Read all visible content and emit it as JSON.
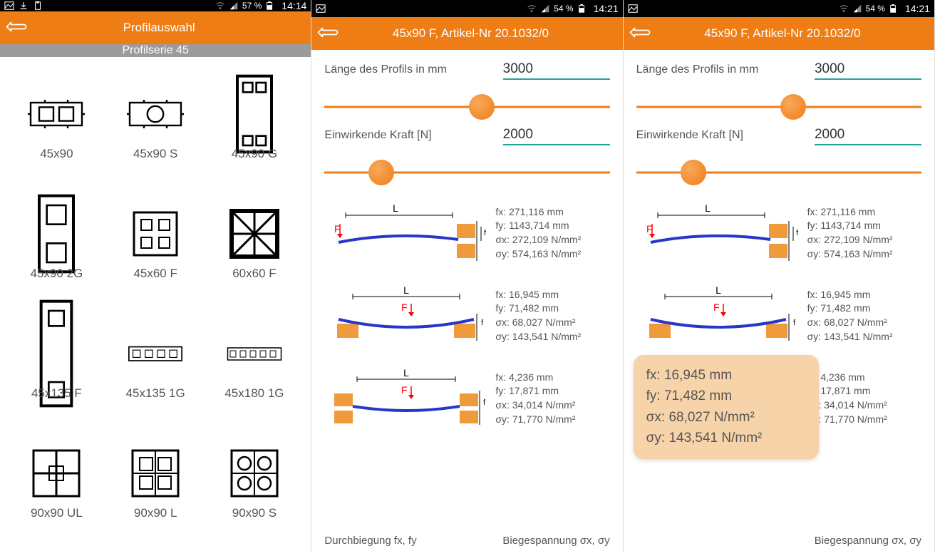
{
  "screens": [
    {
      "statusbar": {
        "battery": "57 %",
        "time": "14:14",
        "left_icons": [
          "image",
          "download",
          "clipboard"
        ]
      },
      "header": {
        "title": "Profilauswahl"
      },
      "subheader": "Profilserie 45",
      "profiles": [
        {
          "label": "45x90"
        },
        {
          "label": "45x90 S"
        },
        {
          "label": "45x90 G"
        },
        {
          "label": "45x90 2G"
        },
        {
          "label": "45x60 F"
        },
        {
          "label": "60x60 F"
        },
        {
          "label": "45x135 F"
        },
        {
          "label": "45x135 1G"
        },
        {
          "label": "45x180 1G"
        },
        {
          "label": "90x90 UL"
        },
        {
          "label": "90x90 L"
        },
        {
          "label": "90x90 S"
        }
      ]
    },
    {
      "statusbar": {
        "battery": "54 %",
        "time": "14:21",
        "left_icons": [
          "image"
        ]
      },
      "header": {
        "title": "45x90 F, Artikel-Nr 20.1032/0"
      },
      "length_label": "Länge des Profils in mm",
      "length_value": "3000",
      "length_slider_pos": 0.55,
      "force_label": "Einwirkende Kraft [N]",
      "force_value": "2000",
      "force_slider_pos": 0.2,
      "cases": [
        {
          "fx": "fx: 271,116 mm",
          "fy": "fy: 1143,714 mm",
          "sx": "σx: 272,109 N/mm²",
          "sy": "σy: 574,163 N/mm²"
        },
        {
          "fx": "fx: 16,945 mm",
          "fy": "fy: 71,482 mm",
          "sx": "σx: 68,027 N/mm²",
          "sy": "σy: 143,541 N/mm²"
        },
        {
          "fx": "fx: 4,236 mm",
          "fy": "fy: 17,871 mm",
          "sx": "σx: 34,014 N/mm²",
          "sy": "σy: 71,770 N/mm²"
        }
      ],
      "footer_left": "Durchbiegung fx, fy",
      "footer_right": "Biegespannung σx, σy"
    },
    {
      "statusbar": {
        "battery": "54 %",
        "time": "14:21",
        "left_icons": [
          "image"
        ]
      },
      "header": {
        "title": "45x90 F, Artikel-Nr 20.1032/0"
      },
      "length_label": "Länge des Profils in mm",
      "length_value": "3000",
      "length_slider_pos": 0.55,
      "force_label": "Einwirkende Kraft [N]",
      "force_value": "2000",
      "force_slider_pos": 0.2,
      "cases": [
        {
          "fx": "fx: 271,116 mm",
          "fy": "fy: 1143,714 mm",
          "sx": "σx: 272,109 N/mm²",
          "sy": "σy: 574,163 N/mm²"
        },
        {
          "fx": "fx: 16,945 mm",
          "fy": "fy: 71,482 mm",
          "sx": "σx: 68,027 N/mm²",
          "sy": "σy: 143,541 N/mm²"
        },
        {
          "fx": "fx: 4,236 mm",
          "fy": "fy: 17,871 mm",
          "sx": "σx: 34,014 N/mm²",
          "sy": "σy: 71,770 N/mm²"
        }
      ],
      "tooltip": {
        "l1": "fx: 16,945 mm",
        "l2": "fy: 71,482 mm",
        "l3": "σx: 68,027 N/mm²",
        "l4": "σy: 143,541 N/mm²"
      },
      "footer_right": "Biegespannung σx, σy"
    }
  ]
}
